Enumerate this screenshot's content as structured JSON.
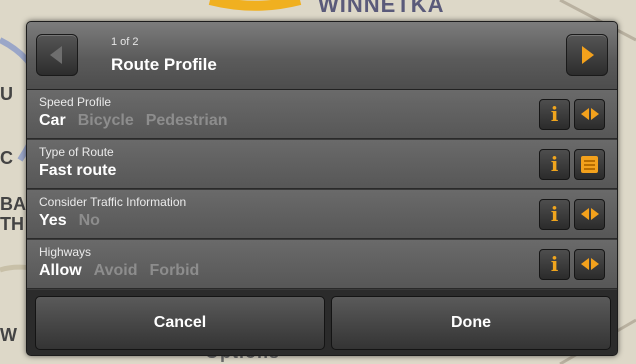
{
  "map": {
    "street_label": "WINNETKA",
    "options_label": "Options",
    "edge_letters": [
      "U",
      "C",
      "BA",
      "TH",
      "W"
    ]
  },
  "dialog": {
    "pager": "1 of 2",
    "title": "Route Profile",
    "accent_color": "#f3a11c",
    "rows": [
      {
        "label": "Speed Profile",
        "options": [
          "Car",
          "Bicycle",
          "Pedestrian"
        ],
        "selected": "Car",
        "action_icon": "left-right-arrows-icon"
      },
      {
        "label": "Type of Route",
        "options": [
          "Fast route"
        ],
        "selected": "Fast route",
        "action_icon": "list-icon"
      },
      {
        "label": "Consider Traffic Information",
        "options": [
          "Yes",
          "No"
        ],
        "selected": "Yes",
        "action_icon": "left-right-arrows-icon"
      },
      {
        "label": "Highways",
        "options": [
          "Allow",
          "Avoid",
          "Forbid"
        ],
        "selected": "Allow",
        "action_icon": "left-right-arrows-icon"
      }
    ],
    "cancel_label": "Cancel",
    "done_label": "Done"
  }
}
